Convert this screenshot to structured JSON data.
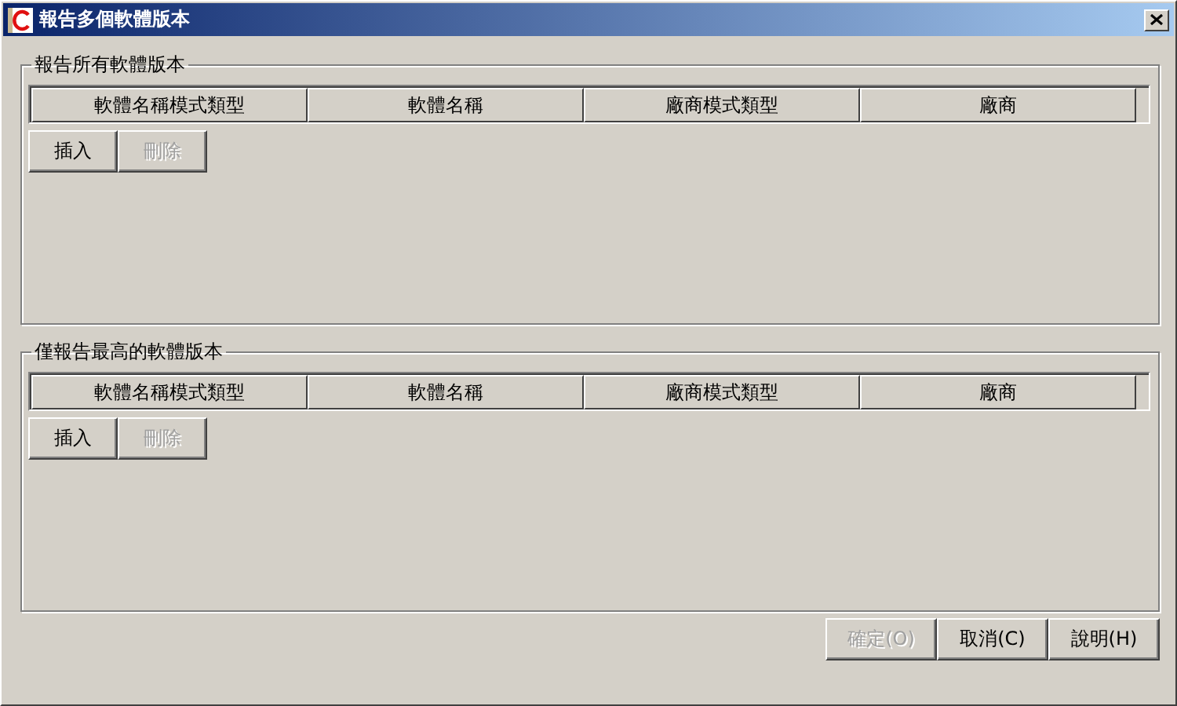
{
  "window": {
    "title": "報告多個軟體版本"
  },
  "groups": [
    {
      "title": "報告所有軟體版本",
      "table": {
        "columns": [
          "軟體名稱模式類型",
          "軟體名稱",
          "廠商模式類型",
          "廠商"
        ]
      },
      "buttons": [
        {
          "label": "插入",
          "disabled": false
        },
        {
          "label": "刪除",
          "disabled": true
        }
      ]
    },
    {
      "title": "僅報告最高的軟體版本",
      "table": {
        "columns": [
          "軟體名稱模式類型",
          "軟體名稱",
          "廠商模式類型",
          "廠商"
        ]
      },
      "buttons": [
        {
          "label": "插入",
          "disabled": false
        },
        {
          "label": "刪除",
          "disabled": true
        }
      ]
    }
  ],
  "buttons": [
    {
      "label": "確定(O)",
      "disabled": true
    },
    {
      "label": "取消(C)",
      "disabled": false
    },
    {
      "label": "說明(H)",
      "disabled": false
    }
  ]
}
